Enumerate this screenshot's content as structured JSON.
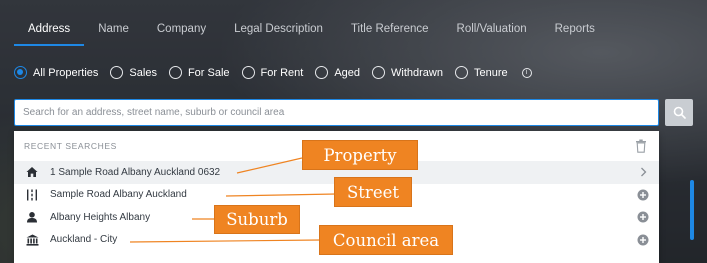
{
  "tabs": [
    {
      "label": "Address",
      "active": true
    },
    {
      "label": "Name"
    },
    {
      "label": "Company"
    },
    {
      "label": "Legal Description"
    },
    {
      "label": "Title Reference"
    },
    {
      "label": "Roll/Valuation"
    },
    {
      "label": "Reports"
    }
  ],
  "filters": {
    "options": [
      {
        "label": "All Properties",
        "checked": true
      },
      {
        "label": "Sales"
      },
      {
        "label": "For Sale"
      },
      {
        "label": "For Rent"
      },
      {
        "label": "Aged"
      },
      {
        "label": "Withdrawn"
      },
      {
        "label": "Tenure"
      }
    ],
    "info_icon": "info-icon"
  },
  "search": {
    "placeholder": "Search for an address, street name, suburb or council area",
    "value": ""
  },
  "recent": {
    "title": "RECENT SEARCHES",
    "items": [
      {
        "label": "1 Sample Road Albany Auckland 0632",
        "icon": "house-icon",
        "action": "chevron-right-icon"
      },
      {
        "label": "Sample Road Albany Auckland",
        "icon": "street-icon",
        "action": "plus-circle-icon"
      },
      {
        "label": "Albany Heights Albany",
        "icon": "suburb-person-icon",
        "action": "plus-circle-icon"
      },
      {
        "label": "Auckland - City",
        "icon": "council-building-icon",
        "action": "plus-circle-icon"
      }
    ]
  },
  "annotations": {
    "property": "Property",
    "street": "Street",
    "suburb": "Suburb",
    "council": "Council area"
  },
  "colors": {
    "accent": "#1e88e5",
    "callout": "#ef8422"
  }
}
